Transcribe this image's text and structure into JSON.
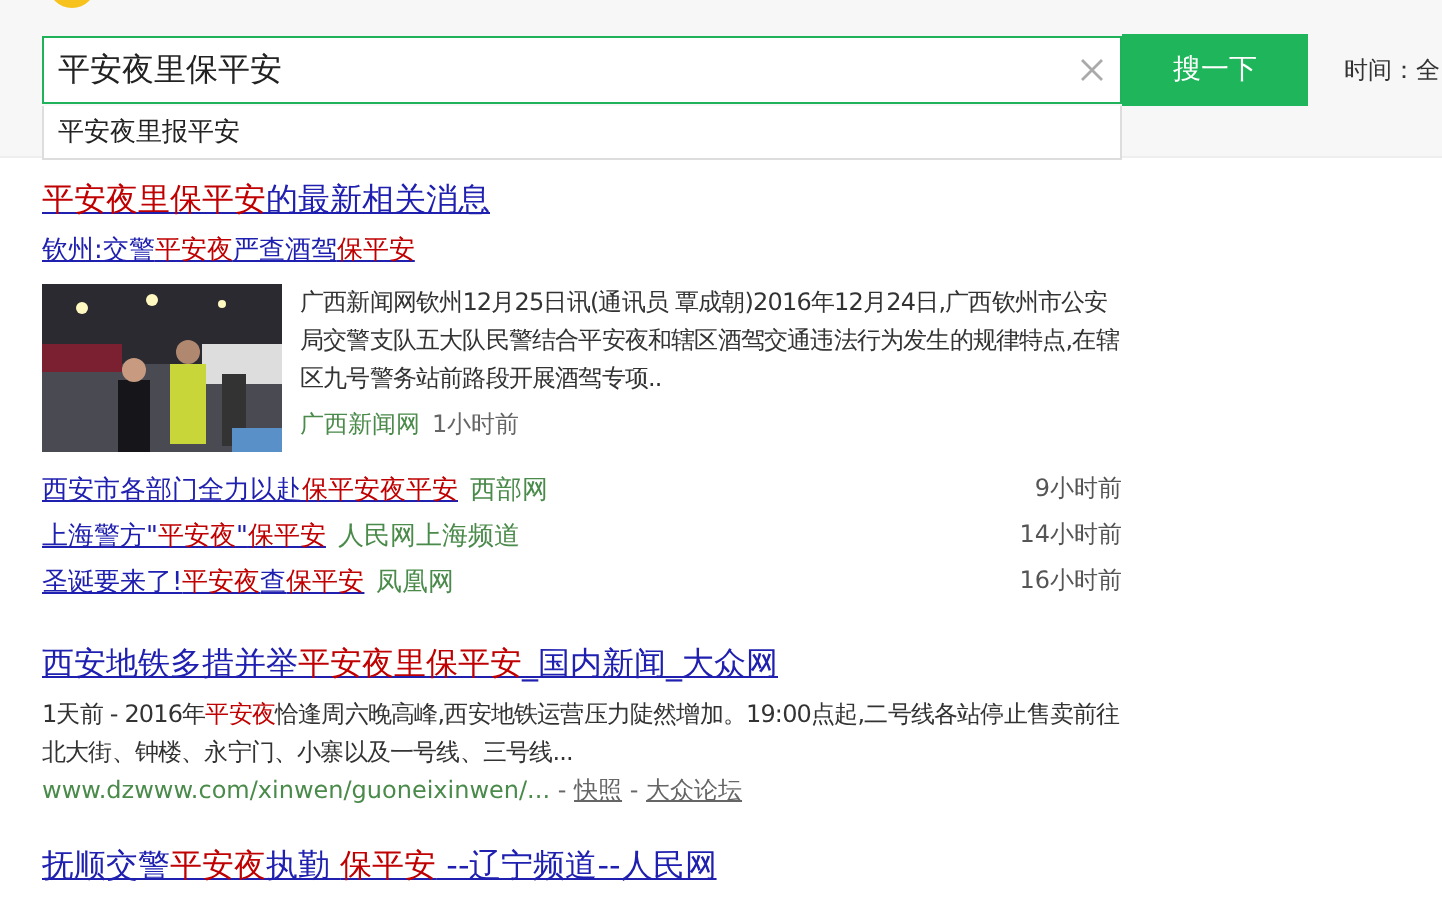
{
  "header": {
    "query": "平安夜里保平安",
    "search_button": "搜一下",
    "time_filter": "时间：全"
  },
  "suggestions": [
    "平安夜里报平安"
  ],
  "news_block": {
    "title": [
      {
        "text": "平安夜里保平安",
        "highlight": true
      },
      {
        "text": "的最新相关消息",
        "highlight": false
      }
    ],
    "lead": {
      "title": [
        {
          "text": "钦州:交警",
          "highlight": false
        },
        {
          "text": "平安夜",
          "highlight": true
        },
        {
          "text": "严查酒驾",
          "highlight": false
        },
        {
          "text": "保平安",
          "highlight": true
        }
      ],
      "snippet": "广西新闻网钦州12月25日讯(通讯员 覃成朝)2016年12月24日,广西钦州市公安局交警支队五大队民警结合平安夜和辖区酒驾交通违法行为发生的规律特点,在辖区九号警务站前路段开展酒驾专项..",
      "source": "广西新闻网",
      "time": "1小时前"
    },
    "items": [
      {
        "title": [
          {
            "text": "西安市各部门全力以赴",
            "highlight": false
          },
          {
            "text": "保平安夜平安",
            "highlight": true
          }
        ],
        "source": "西部网",
        "time": "9小时前"
      },
      {
        "title": [
          {
            "text": "上海警方\"",
            "highlight": false
          },
          {
            "text": "平安夜",
            "highlight": true
          },
          {
            "text": "\"",
            "highlight": false
          },
          {
            "text": "保平安",
            "highlight": true
          }
        ],
        "source": "人民网上海频道",
        "time": "14小时前"
      },
      {
        "title": [
          {
            "text": "圣诞要来了!",
            "highlight": false
          },
          {
            "text": "平安夜",
            "highlight": true
          },
          {
            "text": "查",
            "highlight": false
          },
          {
            "text": "保平安",
            "highlight": true
          }
        ],
        "source": "凤凰网",
        "time": "16小时前"
      }
    ]
  },
  "results": [
    {
      "title": [
        {
          "text": "西安地铁多措并举",
          "highlight": false
        },
        {
          "text": "平安夜里保平安",
          "highlight": true
        },
        {
          "text": "_国内新闻_大众网",
          "highlight": false
        }
      ],
      "snippet": [
        {
          "text": "1天前 - 2016年",
          "highlight": false
        },
        {
          "text": "平安夜",
          "highlight": true
        },
        {
          "text": "恰逢周六晚高峰,西安地铁运营压力陡然增加。19:00点起,二号线各站停止售卖前往北大街、钟楼、永宁门、小寨以及一号线、三号线...",
          "highlight": false
        }
      ],
      "url": "www.dzwww.com/xinwen/guoneixinwen/...",
      "links": [
        {
          "sep": "-",
          "label": "快照"
        },
        {
          "sep": "-",
          "label": "大众论坛"
        }
      ]
    },
    {
      "title": [
        {
          "text": "抚顺交警",
          "highlight": false
        },
        {
          "text": "平安夜",
          "highlight": true
        },
        {
          "text": "执勤 ",
          "highlight": false
        },
        {
          "text": "保平安",
          "highlight": true
        },
        {
          "text": " --辽宁频道--人民网",
          "highlight": false
        }
      ]
    }
  ]
}
